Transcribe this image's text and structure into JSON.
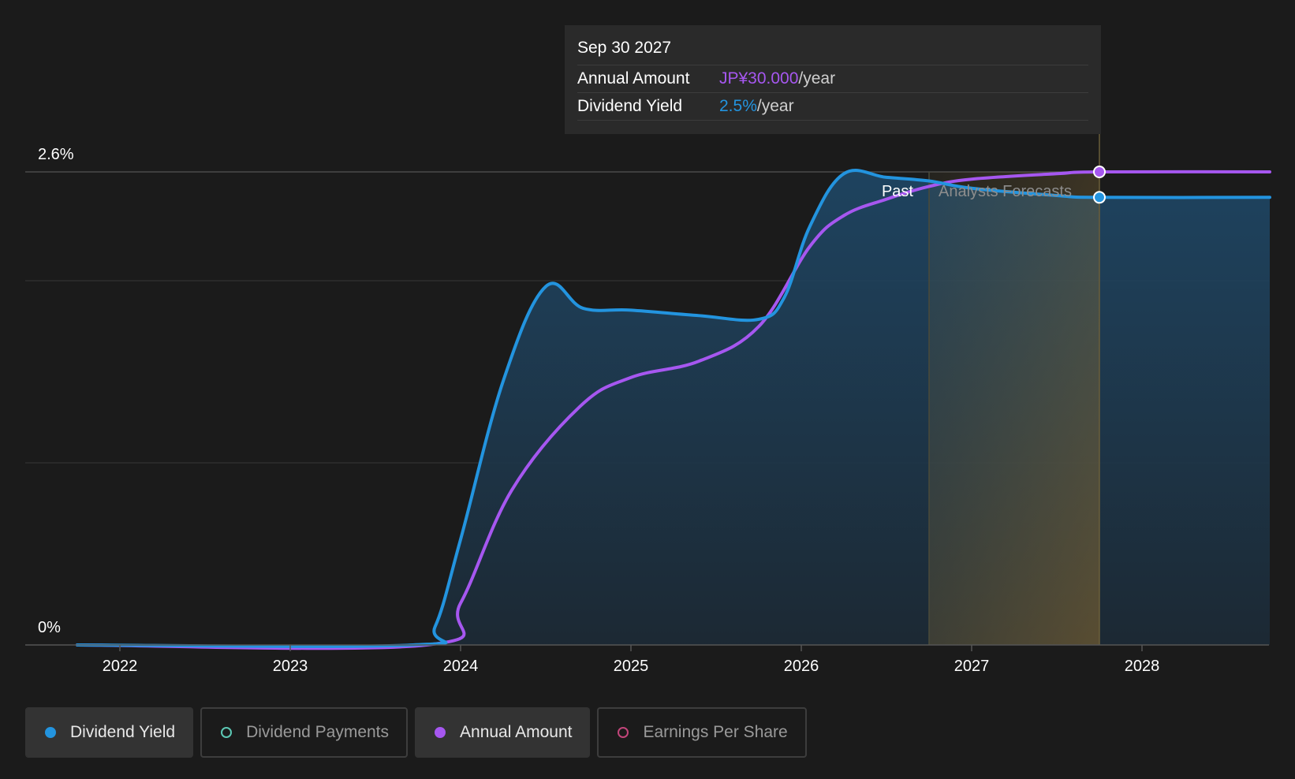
{
  "tooltip": {
    "date": "Sep 30 2027",
    "annual_label": "Annual Amount",
    "annual_value": "JP¥30.000",
    "annual_unit": "/year",
    "yield_label": "Dividend Yield",
    "yield_value": "2.5%",
    "yield_unit": "/year"
  },
  "legend": [
    {
      "label": "Dividend Yield",
      "color": "#2394df",
      "active": true,
      "filled": true
    },
    {
      "label": "Dividend Payments",
      "color": "#5cc8b4",
      "active": false,
      "filled": false
    },
    {
      "label": "Annual Amount",
      "color": "#a657f0",
      "active": true,
      "filled": true
    },
    {
      "label": "Earnings Per Share",
      "color": "#c2457a",
      "active": false,
      "filled": false
    }
  ],
  "colors": {
    "background": "#1b1b1b",
    "yield": "#2394df",
    "annual": "#a657f0",
    "grid": "#333333"
  },
  "chart_data": {
    "type": "line",
    "x_ticks": [
      "2022",
      "2023",
      "2024",
      "2025",
      "2026",
      "2027",
      "2028"
    ],
    "y_labels": [
      "2.6%",
      "0%"
    ],
    "ylim": [
      0,
      2.6
    ],
    "x_range": [
      2021.72,
      2028.75
    ],
    "past_label": "Past",
    "forecast_label": "Analysts Forecasts",
    "past_end": 2026.75,
    "forecast_end": 2027.75,
    "grid": true,
    "series": [
      {
        "name": "Dividend Yield",
        "unit": "%",
        "points": [
          [
            2021.75,
            0
          ],
          [
            2023.72,
            0
          ],
          [
            2023.85,
            0.1
          ],
          [
            2024.0,
            0.58
          ],
          [
            2024.25,
            1.45
          ],
          [
            2024.5,
            1.97
          ],
          [
            2024.72,
            1.85
          ],
          [
            2025.0,
            1.84
          ],
          [
            2025.4,
            1.81
          ],
          [
            2025.75,
            1.79
          ],
          [
            2025.9,
            1.91
          ],
          [
            2026.05,
            2.3
          ],
          [
            2026.25,
            2.59
          ],
          [
            2026.5,
            2.57
          ],
          [
            2026.75,
            2.55
          ],
          [
            2027.0,
            2.51
          ],
          [
            2027.5,
            2.47
          ],
          [
            2027.75,
            2.46
          ],
          [
            2028.75,
            2.46
          ]
        ]
      },
      {
        "name": "Annual Amount",
        "unit": "JP¥",
        "points": [
          [
            2021.75,
            0
          ],
          [
            2023.8,
            0
          ],
          [
            2024.0,
            0.23
          ],
          [
            2024.3,
            0.85
          ],
          [
            2024.7,
            1.31
          ],
          [
            2025.0,
            1.47
          ],
          [
            2025.4,
            1.56
          ],
          [
            2025.75,
            1.75
          ],
          [
            2026.05,
            2.19
          ],
          [
            2026.25,
            2.36
          ],
          [
            2026.5,
            2.45
          ],
          [
            2026.75,
            2.52
          ],
          [
            2027.0,
            2.56
          ],
          [
            2027.5,
            2.59
          ],
          [
            2027.75,
            2.6
          ],
          [
            2028.75,
            2.6
          ]
        ]
      }
    ]
  }
}
